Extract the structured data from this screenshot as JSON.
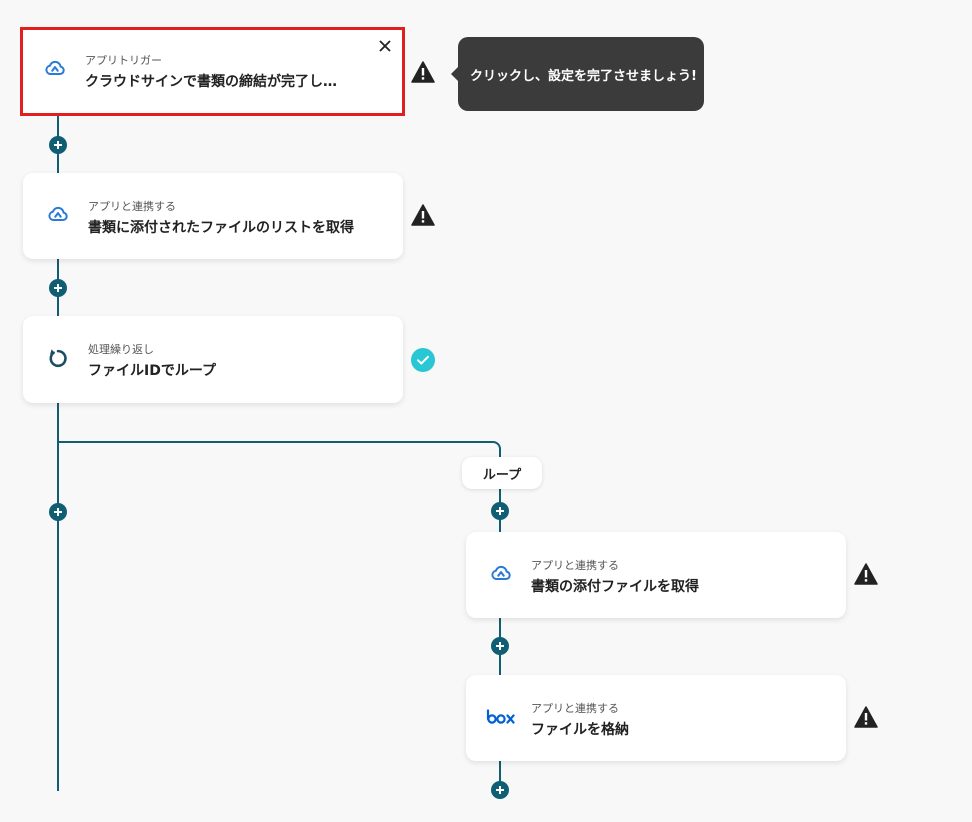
{
  "colors": {
    "line": "#0f5e73",
    "selected_border": "#e0201f",
    "check": "#29c6d4",
    "cloudsign": "#2b7bd6",
    "box": "#0061d5"
  },
  "steps": [
    {
      "sub": "アプリトリガー",
      "title": "クラウドサインで書類の締結が完了し…",
      "icon": "cloudsign-icon",
      "status": "warning"
    },
    {
      "sub": "アプリと連携する",
      "title": "書類に添付されたファイルのリストを取得",
      "icon": "cloudsign-icon",
      "status": "warning"
    },
    {
      "sub": "処理繰り返し",
      "title": "ファイルIDでループ",
      "icon": "loop-icon",
      "status": "done"
    },
    {
      "sub": "アプリと連携する",
      "title": "書類の添付ファイルを取得",
      "icon": "cloudsign-icon",
      "status": "warning"
    },
    {
      "sub": "アプリと連携する",
      "title": "ファイルを格納",
      "icon": "box-icon",
      "status": "warning"
    }
  ],
  "tooltip": "クリックし、設定を完了させましょう!",
  "loop_label": "ループ"
}
